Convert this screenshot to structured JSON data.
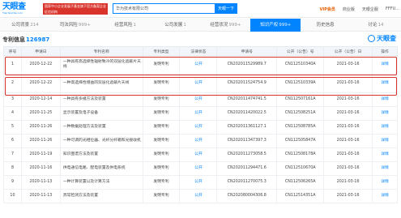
{
  "topbar": {
    "logo_main": "天眼查",
    "logo_sub": "TianYanCha.com",
    "ad_text": "国家中小企业发展子基金旗下官方备案企业征信机构",
    "search_value": "华为技术有限公司",
    "search_button": "天眼一下",
    "vip": "VIP会员",
    "app": "商业版",
    "link1": "天眼企服",
    "user": "FFFU..."
  },
  "tabs": [
    {
      "label": "公司背景",
      "count": "214"
    },
    {
      "label": "司法风险",
      "count": "999+"
    },
    {
      "label": "经营风险",
      "count": "1"
    },
    {
      "label": "公司发展",
      "count": "1"
    },
    {
      "label": "经营状况",
      "count": "999+"
    },
    {
      "label": "知识产权",
      "count": "999+"
    },
    {
      "label": "历史信息",
      "count": ""
    },
    {
      "label": "讨论",
      "count": "14"
    }
  ],
  "section": {
    "title": "专利信息",
    "count": "126987"
  },
  "watermark": "天眼查",
  "table": {
    "headers": [
      "序号",
      "申请日",
      "专利名称",
      "专利类型",
      "法律状态",
      "申请号",
      "公开（公告）号",
      "公开（公告）日",
      "操作"
    ],
    "rows": [
      [
        "1",
        "2020-12-22",
        "一种具有高选择性辐射致冷的双层化遮蔽片天线",
        "发明专利",
        "公开",
        "CN202011529989.7",
        "CN112510340A",
        "2021-03-16",
        "详情"
      ],
      [
        "2",
        "2020-12-22",
        "一种高选择性增益的双层化遮蔽片天线",
        "发明专利",
        "公开",
        "CN202011524754.9",
        "CN112510339A",
        "2021-03-16",
        "详情"
      ],
      [
        "3",
        "2020-12-14",
        "一种具有多播方法及装置",
        "发明专利",
        "公开",
        "CN202011474741.5",
        "CN112507161A",
        "2021-03-16",
        "详情"
      ],
      [
        "4",
        "2020-11-25",
        "显示装置及电子设备",
        "发明专利",
        "公开",
        "CN202011420022.5",
        "CN112508251A",
        "2021-03-16",
        "详情"
      ],
      [
        "5",
        "2020-11-26",
        "一种数据处理方法及装置",
        "发明专利",
        "公开",
        "CN202011361127.1",
        "CN112508785A",
        "2021-03-16",
        "详情"
      ],
      [
        "6",
        "2020-11-26",
        "一种可调的光相位器、光纤分纤箱和光接收机",
        "发明专利",
        "公开",
        "CN202011347397.3",
        "CN112505847A",
        "2021-03-16",
        "详情"
      ],
      [
        "7",
        "2020-11-19",
        "知识图谱方法及装置",
        "发明专利",
        "公开",
        "CN202011273058.5",
        "CN112508178A",
        "2021-03-16",
        "详情"
      ],
      [
        "8",
        "2020-11-16",
        "供电通信电路、配电装置及供电系统",
        "发明专利",
        "公开",
        "CN202011294471.6",
        "CN112510670A",
        "2021-03-16",
        "详情"
      ],
      [
        "9",
        "2020-11-13",
        "一种计算装置以及计算方法",
        "发明专利",
        "公开",
        "CN202011270075.3",
        "CN112506265A",
        "2021-03-16",
        "详情"
      ],
      [
        "10",
        "2020-11-13",
        "异常检测方法及装置",
        "发明专利",
        "公开",
        "CN202080004306.8",
        "CN112514351A",
        "2021-03-16",
        "详情"
      ]
    ]
  }
}
